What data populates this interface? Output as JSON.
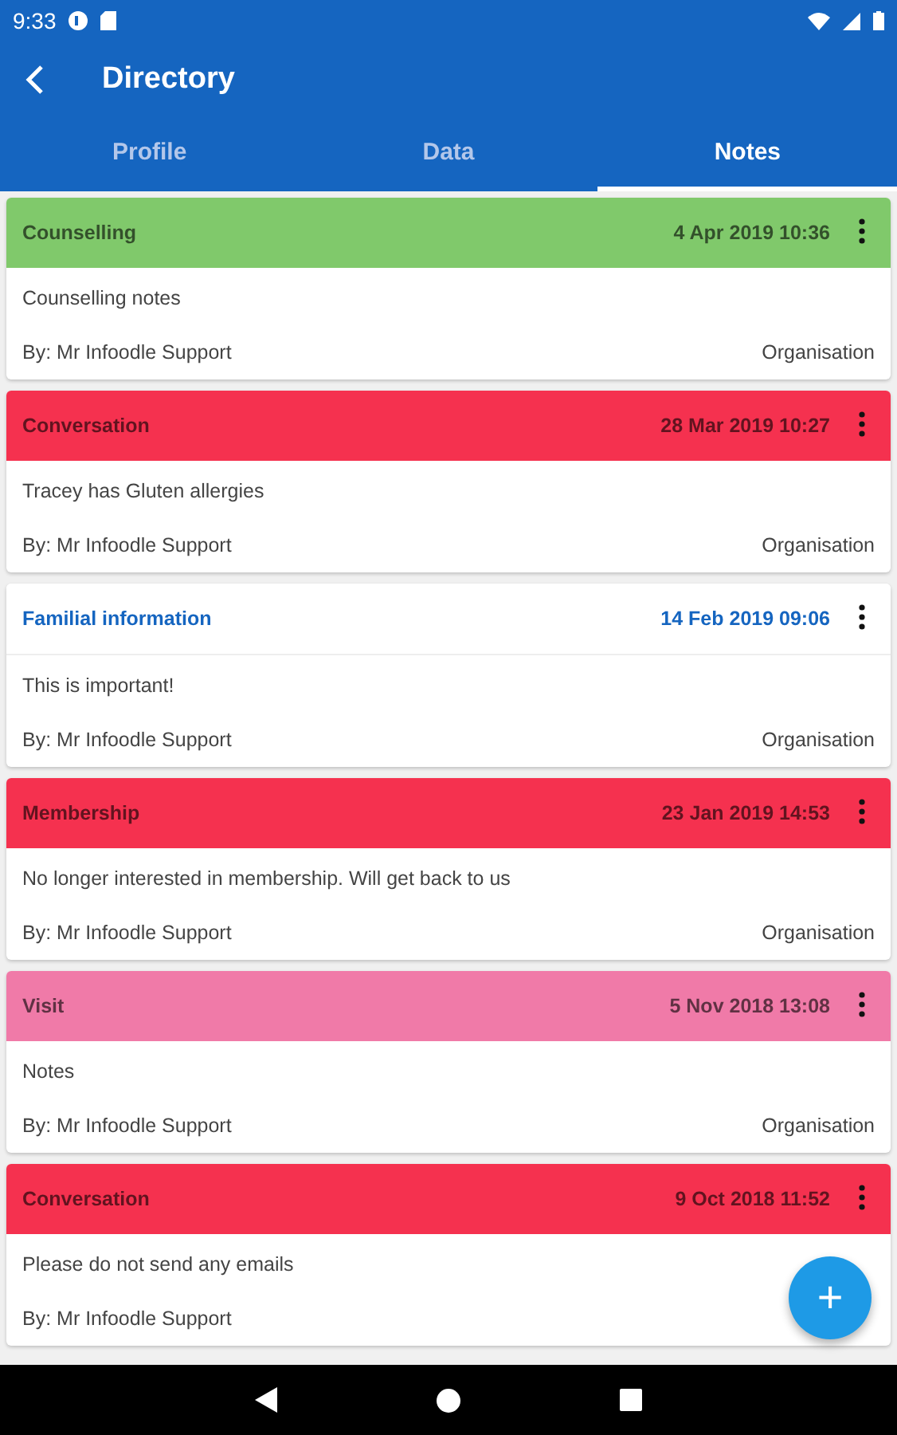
{
  "status_bar": {
    "time": "9:33"
  },
  "app_bar": {
    "title": "Directory"
  },
  "tabs": [
    {
      "label": "Profile",
      "selected": false
    },
    {
      "label": "Data",
      "selected": false
    },
    {
      "label": "Notes",
      "selected": true
    }
  ],
  "notes": [
    {
      "kind": "highlighted",
      "color": "#80c96b",
      "title": "Counselling",
      "date": "4 Apr 2019 10:36",
      "text": "Counselling notes",
      "author": "By: Mr Infoodle Support",
      "scope": "Organisation"
    },
    {
      "kind": "highlighted",
      "color": "#f5314f",
      "title": "Conversation",
      "date": "28 Mar 2019 10:27",
      "text": "Tracey has Gluten allergies",
      "author": "By: Mr Infoodle Support",
      "scope": "Organisation"
    },
    {
      "kind": "plain",
      "color": "#ffffff",
      "title": "Familial information",
      "date": "14 Feb 2019 09:06",
      "text": "This is important!",
      "author": "By: Mr Infoodle Support",
      "scope": "Organisation"
    },
    {
      "kind": "highlighted",
      "color": "#f5314f",
      "title": "Membership",
      "date": "23 Jan 2019 14:53",
      "text": "No longer interested in membership. Will get back to us",
      "author": "By: Mr Infoodle Support",
      "scope": "Organisation"
    },
    {
      "kind": "highlighted",
      "color": "#f07aa8",
      "title": "Visit",
      "date": "5 Nov 2018 13:08",
      "text": "Notes",
      "author": "By: Mr Infoodle Support",
      "scope": "Organisation"
    },
    {
      "kind": "highlighted",
      "color": "#f5314f",
      "title": "Conversation",
      "date": "9 Oct 2018 11:52",
      "text": "Please do not send any emails",
      "author": "By: Mr Infoodle Support"
    }
  ],
  "fab": {
    "label": "+"
  }
}
